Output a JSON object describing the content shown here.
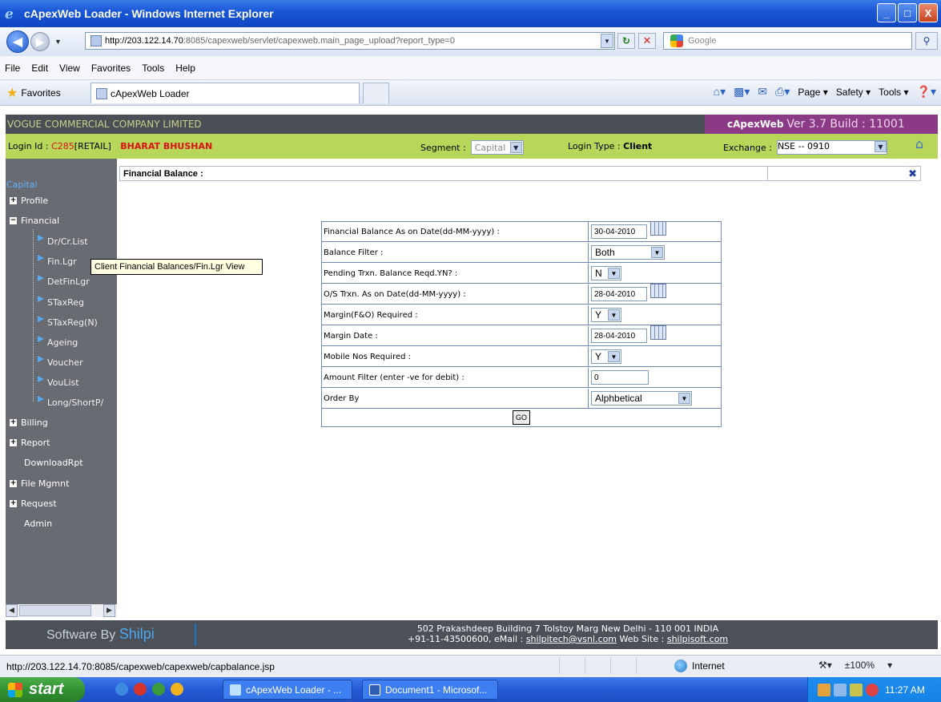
{
  "window": {
    "title": "cApexWeb Loader - Windows Internet Explorer",
    "minimize": "_",
    "maximize": "□",
    "close": "X"
  },
  "address_bar": {
    "url_host": "http://203.122.14.70",
    "url_rest": ":8085/capexweb/servlet/capexweb.main_page_upload?report_type=0",
    "search_placeholder": "Google"
  },
  "menu": [
    "File",
    "Edit",
    "View",
    "Favorites",
    "Tools",
    "Help"
  ],
  "favorites_bar": {
    "favorites_label": "Favorites",
    "active_tab": "cApexWeb Loader",
    "commands": {
      "page": "Page ▾",
      "safety": "Safety ▾",
      "tools": "Tools ▾"
    }
  },
  "app": {
    "company": "VOGUE COMMERCIAL COMPANY LIMITED",
    "brand_name": "cApexWeb",
    "brand_version": "Ver 3.7 Build : 11001",
    "login_label": "Login Id :",
    "login_id": "C285",
    "login_role": "[RETAIL]",
    "user_name": "BHARAT BHUSHAN",
    "segment_label": "Segment :",
    "segment_value": "Capital",
    "login_type_label": "Login Type :",
    "login_type_value": "Client",
    "exchange_label": "Exchange :",
    "exchange_value": "NSE -- 0910"
  },
  "sidebar": {
    "section": "Capital",
    "items": [
      {
        "label": "Profile",
        "pm": "+"
      },
      {
        "label": "Financial",
        "pm": "−"
      },
      {
        "label": "Billing",
        "pm": "+"
      },
      {
        "label": "Report",
        "pm": "+"
      },
      {
        "label": "DownloadRpt",
        "pm": ""
      },
      {
        "label": "File Mgmnt",
        "pm": "+"
      },
      {
        "label": "Request",
        "pm": "+"
      },
      {
        "label": "Admin",
        "pm": ""
      }
    ],
    "sub_items": [
      "Dr/Cr.List",
      "Fin.Lgr",
      "DetFinLgr",
      "STaxReg",
      "STaxReg(N)",
      "Ageing",
      "Voucher",
      "VouList",
      "Long/ShortP/"
    ],
    "tooltip": "Client Financial Balances/Fin.Lgr View"
  },
  "main": {
    "header": "Financial Balance :",
    "form": {
      "rows": [
        {
          "label": "Financial Balance As on Date(dd-MM-yyyy) :",
          "value": "30-04-2010"
        },
        {
          "label": "Balance Filter :",
          "value": "Both"
        },
        {
          "label": "Pending Trxn. Balance Reqd.YN? :",
          "value": "N"
        },
        {
          "label": "O/S Trxn. As on Date(dd-MM-yyyy) :",
          "value": "28-04-2010"
        },
        {
          "label": "Margin(F&O) Required :",
          "value": "Y"
        },
        {
          "label": "Margin Date :",
          "value": "28-04-2010"
        },
        {
          "label": "Mobile Nos Required :",
          "value": "Y"
        },
        {
          "label": "Amount Filter (enter -ve for debit) :",
          "value": "0"
        },
        {
          "label": "Order By",
          "value": "Alphbetical"
        }
      ],
      "go_label": "GO"
    }
  },
  "footer": {
    "software_by": "Software By",
    "shilpi": "Shilpi",
    "address_line1": "502 Prakashdeep Building 7 Tolstoy Marg New Delhi - 110 001 INDIA",
    "address_line2_prefix": "+91-11-43500600, eMail :",
    "email": "shilpitech@vsnl.com",
    "website_label": "Web Site :",
    "website": "shilpisoft.com"
  },
  "statusbar": {
    "url": "http://203.122.14.70:8085/capexweb/capexweb/capbalance.jsp",
    "zone": "Internet",
    "zoom": "±100%"
  },
  "taskbar": {
    "start": "start",
    "items": [
      "cApexWeb Loader - ...",
      "Document1 - Microsof..."
    ],
    "clock": "11:27 AM"
  },
  "colors": {
    "app_header_bg": "#4a4e57",
    "brand_bg": "#8b3a85",
    "login_bar_bg": "#b8d75a",
    "sidebar_bg": "#696b72",
    "accent_red": "#dd1111"
  }
}
